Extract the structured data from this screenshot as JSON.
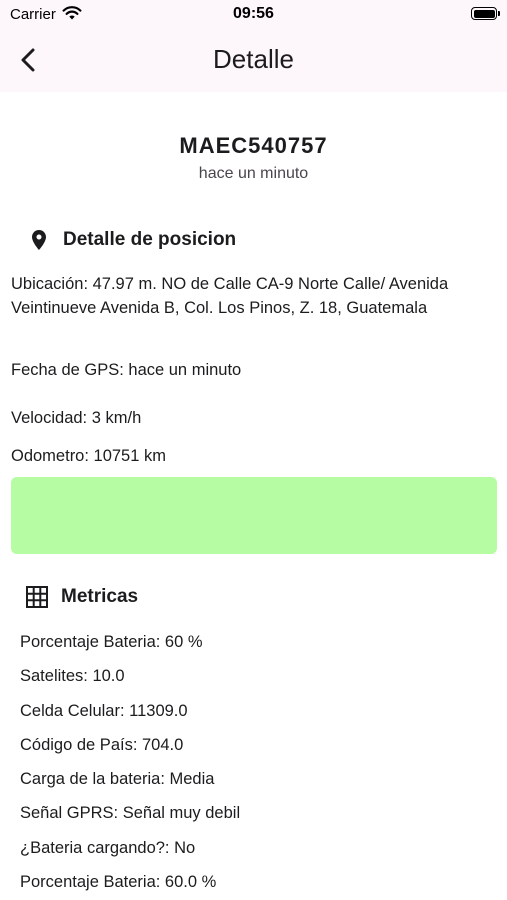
{
  "status_bar": {
    "carrier": "Carrier",
    "time": "09:56"
  },
  "app_bar": {
    "title": "Detalle"
  },
  "device": {
    "id": "MAEC540757",
    "updated": "hace un minuto"
  },
  "position": {
    "section_title": "Detalle de posicion",
    "address": "Ubicación: 47.97 m. NO de  Calle CA-9 Norte Calle/ Avenida Veintinueve Avenida B, Col. Los Pinos, Z. 18, Guatemala",
    "gps_date": "Fecha de GPS: hace un minuto",
    "speed": "Velocidad: 3 km/h",
    "odometer": "Odometro: 10751 km",
    "banner_color": "#b5fca2"
  },
  "metrics": {
    "section_title": "Metricas",
    "items": [
      "Porcentaje Bateria: 60 %",
      "Satelites: 10.0",
      "Celda Celular: 11309.0",
      "Código de País: 704.0",
      "Carga de la bateria: Media",
      "Señal GPRS: Señal muy debil",
      "¿Bateria cargando?: No",
      "Porcentaje Bateria: 60.0 %"
    ]
  }
}
